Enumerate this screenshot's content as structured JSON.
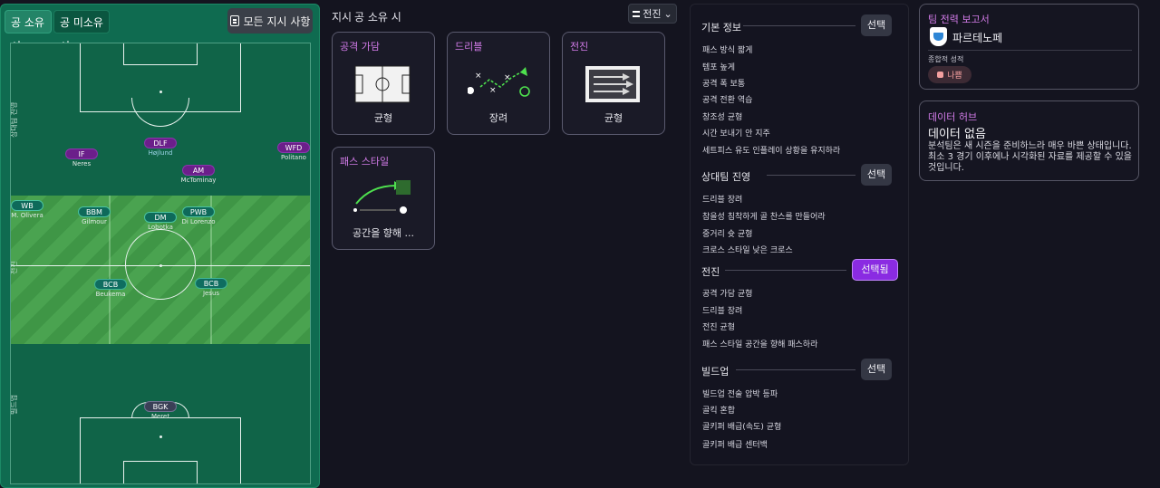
{
  "pitch": {
    "tabs": [
      "공 소유 시",
      "공 미소유 시"
    ],
    "all_instructions_label": "모든 지시 사항",
    "zones": [
      "상대팀 진영",
      "전진",
      "빌드업"
    ],
    "players": [
      {
        "pos": "IF",
        "name": "Neres",
        "line": "att"
      },
      {
        "pos": "DLF",
        "name": "Højlund",
        "line": "att",
        "highlight": true
      },
      {
        "pos": "AM",
        "name": "McTominay",
        "line": "att"
      },
      {
        "pos": "WFD",
        "name": "Politano",
        "line": "att"
      },
      {
        "pos": "WB",
        "name": "M. Olivera",
        "line": "mid"
      },
      {
        "pos": "BBM",
        "name": "Gilmour",
        "line": "mid"
      },
      {
        "pos": "DM",
        "name": "Lobotka",
        "line": "mid"
      },
      {
        "pos": "PWB",
        "name": "Di Lorenzo",
        "line": "mid"
      },
      {
        "pos": "BCB",
        "name": "Beukema",
        "line": "def"
      },
      {
        "pos": "BCB",
        "name": "Jesus",
        "line": "def"
      },
      {
        "pos": "BGK",
        "name": "Meret",
        "line": "gk"
      }
    ]
  },
  "middle": {
    "header_label": "지시",
    "header_phase": "공 소유 시",
    "dropdown_value": "전진",
    "cards": [
      {
        "title": "공격 가담",
        "value": "균형"
      },
      {
        "title": "드리블",
        "value": "장려"
      },
      {
        "title": "전진",
        "value": "균형"
      },
      {
        "title": "패스 스타일",
        "value": "공간을 향해 ..."
      }
    ]
  },
  "instructions": {
    "sections": [
      {
        "title": "기본 정보",
        "button": "선택",
        "active": false,
        "items": [
          "패스 방식 짧게",
          "템포 높게",
          "공격 폭 보통",
          "공격 전환 역습",
          "창조성 균형",
          "시간 보내기 안 지주",
          "세트피스 유도 인플레이 상황을 유지하라"
        ]
      },
      {
        "title": "상대팀 진영",
        "button": "선택",
        "active": false,
        "items": [
          "드리블 장려",
          "참을성 침착하게 골 찬스를 만들어라",
          "중거리 슛 균형",
          "크로스 스타일 낮은 크로스"
        ]
      },
      {
        "title": "전진",
        "button": "선택됨",
        "active": true,
        "items": [
          "공격 가담 균형",
          "드리블 장려",
          "전진 균형",
          "패스 스타일 공간을 향해 패스하라"
        ]
      },
      {
        "title": "빌드업",
        "button": "선택",
        "active": false,
        "items": [
          "빌드업 전술 압박 등파",
          "골킥 혼합",
          "골키퍼 배급(속도) 균형",
          "골키퍼 배급 센터백"
        ]
      }
    ]
  },
  "report": {
    "title": "팀 전력 보고서",
    "team_name": "파르테노페",
    "overall_label": "종합적 성적",
    "rating": "나쁨"
  },
  "hub": {
    "title": "데이터 허브",
    "no_data": "데이터 없음",
    "message": "분석팀은 새 시즌을 준비하느라 매우 바쁜 상태입니다. 최소 3 경기 이후에나 시각화된 자료를 제공할 수 있을 것입니다."
  }
}
